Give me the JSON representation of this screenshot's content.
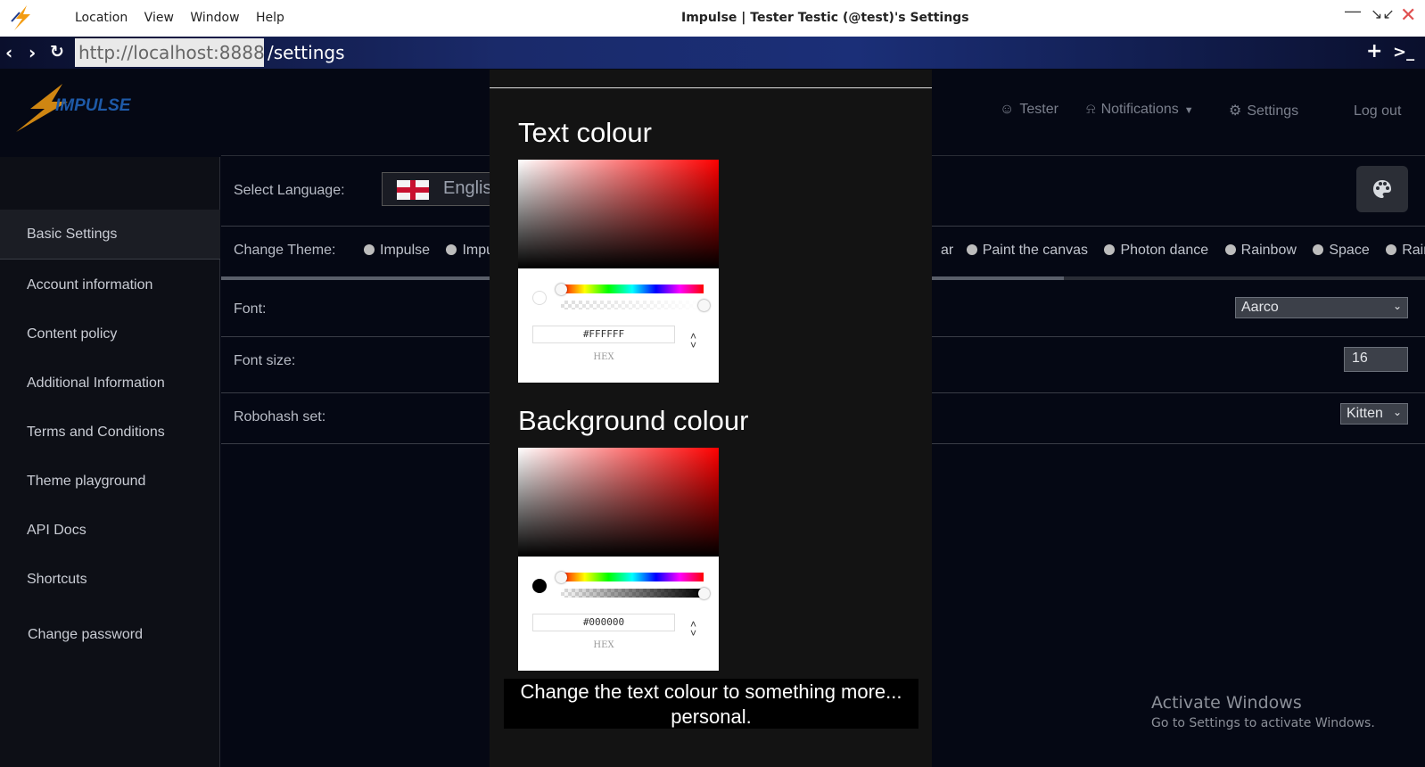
{
  "titlebar": {
    "menu": [
      "Location",
      "View",
      "Window",
      "Help"
    ],
    "window_title": "Impulse | Tester Testic (@test)'s Settings"
  },
  "urlbar": {
    "host": "http://localhost:8888",
    "path": "/settings"
  },
  "app": {
    "brand": "IMPULSE",
    "nav": {
      "user": "Tester",
      "notifications": "Notifications",
      "settings": "Settings",
      "logout": "Log out"
    }
  },
  "sidebar": {
    "items": [
      "Basic Settings",
      "Account information",
      "Content policy",
      "Additional Information",
      "Terms and Conditions",
      "Theme playground",
      "API Docs",
      "Shortcuts",
      "Change password"
    ]
  },
  "settings": {
    "language_label": "Select Language:",
    "language_value": "Englis",
    "theme_label": "Change Theme:",
    "themes_left": [
      "Impulse",
      "Impuls"
    ],
    "themes_right_partial": "ar",
    "themes_right": [
      "Paint the canvas",
      "Photon dance",
      "Rainbow",
      "Space",
      "Rain"
    ],
    "font_label": "Font:",
    "font_value": "Aarco",
    "font_size_label": "Font size:",
    "font_size_value": "16",
    "robohash_label": "Robohash set:",
    "robohash_value": "Kitten"
  },
  "modal": {
    "text_colour_title": "Text colour",
    "text_colour_hex": "#FFFFFF",
    "background_colour_title": "Background colour",
    "background_colour_hex": "#000000",
    "hex_label": "HEX",
    "caption": "Change the text colour to something more... personal."
  },
  "watermark": {
    "line1": "Activate Windows",
    "line2": "Go to Settings to activate Windows."
  },
  "colors": {
    "accent_orange": "#f39c12",
    "brand_blue": "#1e5aa8",
    "page_bg": "#050814"
  }
}
